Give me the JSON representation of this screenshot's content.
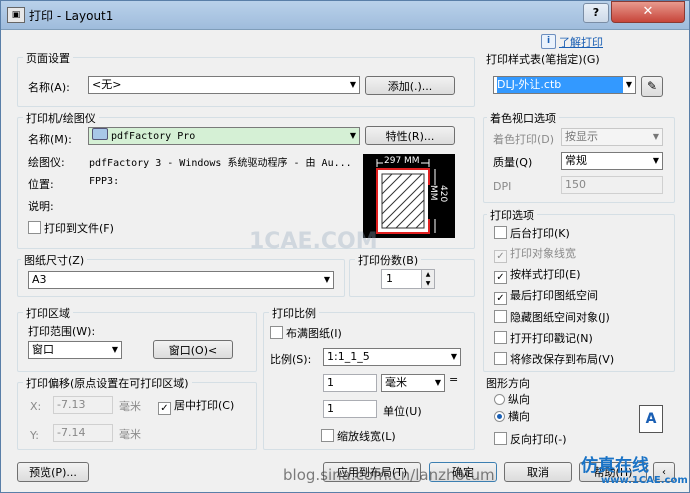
{
  "window": {
    "title": "打印 - Layout1",
    "help_label": "?",
    "close_label": "✕",
    "learn_link": "了解打印"
  },
  "page_setup": {
    "group_label": "页面设置",
    "name_label": "名称(A):",
    "name_value": "<无>",
    "add_button": "添加(.)..."
  },
  "plotter": {
    "group_label": "打印机/绘图仪",
    "name_label": "名称(M):",
    "name_value": "pdfFactory Pro",
    "properties_button": "特性(R)...",
    "plotter_label": "绘图仪:",
    "plotter_value": "pdfFactory 3 - Windows 系统驱动程序 - 由 Au...",
    "location_label": "位置:",
    "location_value": "FPP3:",
    "description_label": "说明:",
    "plot_to_file": "打印到文件(F)",
    "dim_width": "297 MM",
    "dim_height": "420 MM"
  },
  "paper_size": {
    "group_label": "图纸尺寸(Z)",
    "value": "A3"
  },
  "copies": {
    "group_label": "打印份数(B)",
    "value": "1"
  },
  "plot_area": {
    "group_label": "打印区域",
    "range_label": "打印范围(W):",
    "range_value": "窗口",
    "window_button": "窗口(O)<"
  },
  "plot_offset": {
    "group_label": "打印偏移(原点设置在可打印区域)",
    "x_label": "X:",
    "x_value": "-7.13",
    "x_unit": "毫米",
    "y_label": "Y:",
    "y_value": "-7.14",
    "y_unit": "毫米",
    "center_plot": "居中打印(C)"
  },
  "plot_scale": {
    "group_label": "打印比例",
    "fit_to_paper": "布满图纸(I)",
    "scale_label": "比例(S):",
    "scale_value": "1:1_1_5",
    "value1": "1",
    "unit_value": "毫米",
    "equals": "=",
    "value2": "1",
    "unit_label": "单位(U)",
    "scale_lineweights": "缩放线宽(L)"
  },
  "plot_style_table": {
    "group_label": "打印样式表(笔指定)(G)",
    "value": "DLJ-外让.ctb"
  },
  "shaded_viewport": {
    "group_label": "着色视口选项",
    "shade_label": "着色打印(D)",
    "shade_value": "按显示",
    "quality_label": "质量(Q)",
    "quality_value": "常规",
    "dpi_label": "DPI",
    "dpi_value": "150"
  },
  "plot_options": {
    "group_label": "打印选项",
    "items": [
      {
        "label": "后台打印(K)",
        "checked": false,
        "disabled": false
      },
      {
        "label": "打印对象线宽",
        "checked": true,
        "disabled": true
      },
      {
        "label": "按样式打印(E)",
        "checked": true,
        "disabled": false
      },
      {
        "label": "最后打印图纸空间",
        "checked": true,
        "disabled": false
      },
      {
        "label": "隐藏图纸空间对象(J)",
        "checked": false,
        "disabled": false
      },
      {
        "label": "打开打印戳记(N)",
        "checked": false,
        "disabled": false
      },
      {
        "label": "将修改保存到布局(V)",
        "checked": false,
        "disabled": false
      }
    ]
  },
  "orientation": {
    "group_label": "图形方向",
    "portrait": "纵向",
    "landscape": "横向",
    "upside_down": "反向打印(-)",
    "orientation_icon_letter": "A"
  },
  "footer": {
    "preview_button": "预览(P)...",
    "apply_button": "应用到布局(T)",
    "ok_button": "确定",
    "cancel_button": "取消",
    "help_button": "帮助(H)"
  },
  "watermarks": {
    "center": "1CAE.COM",
    "bottom": "blog.sina.com.cn/lanzhotum",
    "corner_brand": "仿真在线",
    "corner_url": "www.1CAE.com"
  },
  "colors": {
    "accent_blue": "#3399ff",
    "highlight_green": "#d5f0d5",
    "paper_red": "#e02020"
  }
}
